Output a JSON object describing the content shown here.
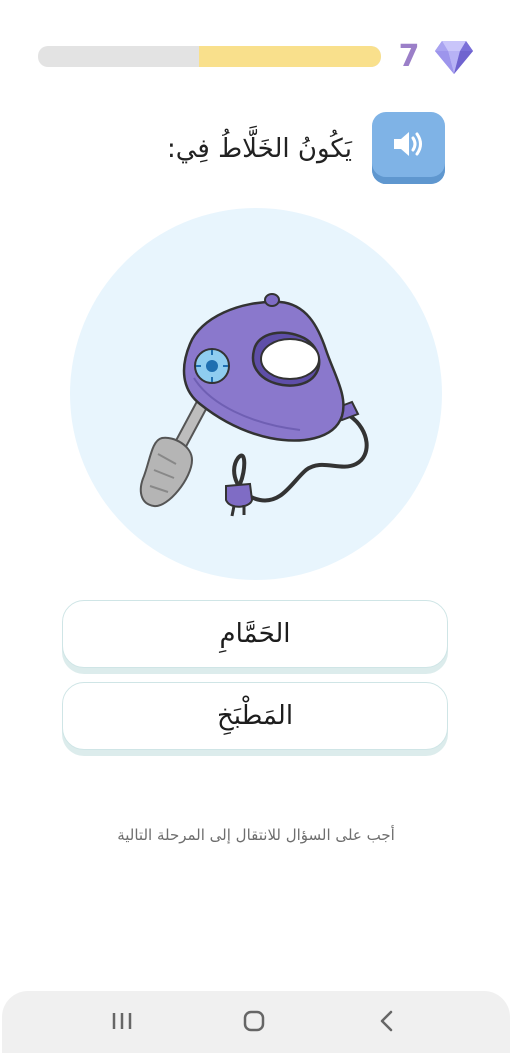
{
  "progress": {
    "value": 0.53
  },
  "gems": {
    "count": "7",
    "icon": "diamond-icon"
  },
  "question": {
    "audio_icon": "speaker-icon",
    "text": "يَكُونُ الخَلَّاطُ فِي:"
  },
  "illustration": {
    "icon": "hand-mixer-icon"
  },
  "choices": [
    {
      "label": "الحَمَّامِ"
    },
    {
      "label": "المَطْبَخِ"
    }
  ],
  "hint": "أجب على السؤال للانتقال إلى المرحلة التالية",
  "navbar": {
    "icons": [
      "recent-apps-icon",
      "home-icon",
      "back-icon"
    ]
  },
  "colors": {
    "progress_fill": "#f9e08c",
    "progress_track": "#e3e3e3",
    "gem_count": "#9b7fc8",
    "audio_button": "#7fb3e6",
    "illustration_bg": "#e8f5fd"
  }
}
